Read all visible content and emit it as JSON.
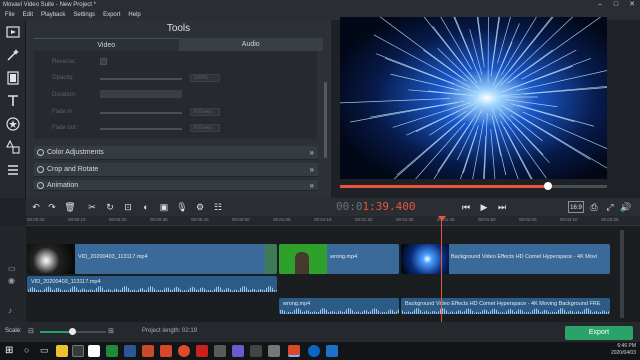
{
  "window": {
    "title": "Movavi Video Suite - New Project *"
  },
  "menu": [
    "File",
    "Edit",
    "Playback",
    "Settings",
    "Export",
    "Help"
  ],
  "left_tools": [
    "import-icon",
    "magic-wand-icon",
    "filters-icon",
    "titles-icon",
    "stickers-icon",
    "transitions-icon",
    "more-icon"
  ],
  "tools": {
    "title": "Tools",
    "tabs": [
      "Video",
      "Audio"
    ],
    "active_tab": "Video",
    "props": {
      "reverse": "Reverse:",
      "opacity": "Opacity:",
      "opacity_val": "100%",
      "duration": "Duration:",
      "fade_in": "Fade in:",
      "fade_in_val": "0.0 sec.",
      "fade_out": "Fade out:",
      "fade_out_val": "0.0 sec."
    },
    "sections": [
      "Color Adjustments",
      "Crop and Rotate",
      "Animation"
    ]
  },
  "player": {
    "timecode_dim": "00:0",
    "timecode_lit": "1:39.400",
    "aspect": "16:9",
    "progress": 0.78
  },
  "ruler": [
    "00:00:00",
    "00:00:10",
    "00:00:20",
    "00:00:30",
    "00:00:40",
    "00:00:50",
    "00:01:00",
    "00:01:10",
    "00:01:20",
    "00:01:30",
    "00:01:40",
    "00:01:50",
    "00:02:00",
    "00:02:10",
    "00:02:20",
    "00:02:30"
  ],
  "clips": {
    "v1": "VID_20200403_113117.mp4",
    "v2": "wrong.mp4",
    "v3": "Background Video Effects HD Comet Hyperspace - 4K Movi",
    "a1": "VID_20200403_113117.mp4",
    "a2": "wrong.mp4",
    "a3": "Background Video Effects HD Comet Hyperspace - 4K Moving Background FRE"
  },
  "bottom": {
    "scale_label": "Scale:",
    "project_length": "Project length:  02:19",
    "export": "Export"
  },
  "tray": {
    "time": "6:46 PM",
    "date": "2020/04/03"
  },
  "colors": {
    "accent": "#e8553a",
    "export": "#2aa36b",
    "video_clip": "#3a6a9a",
    "audio_clip": "#2c5b86"
  }
}
